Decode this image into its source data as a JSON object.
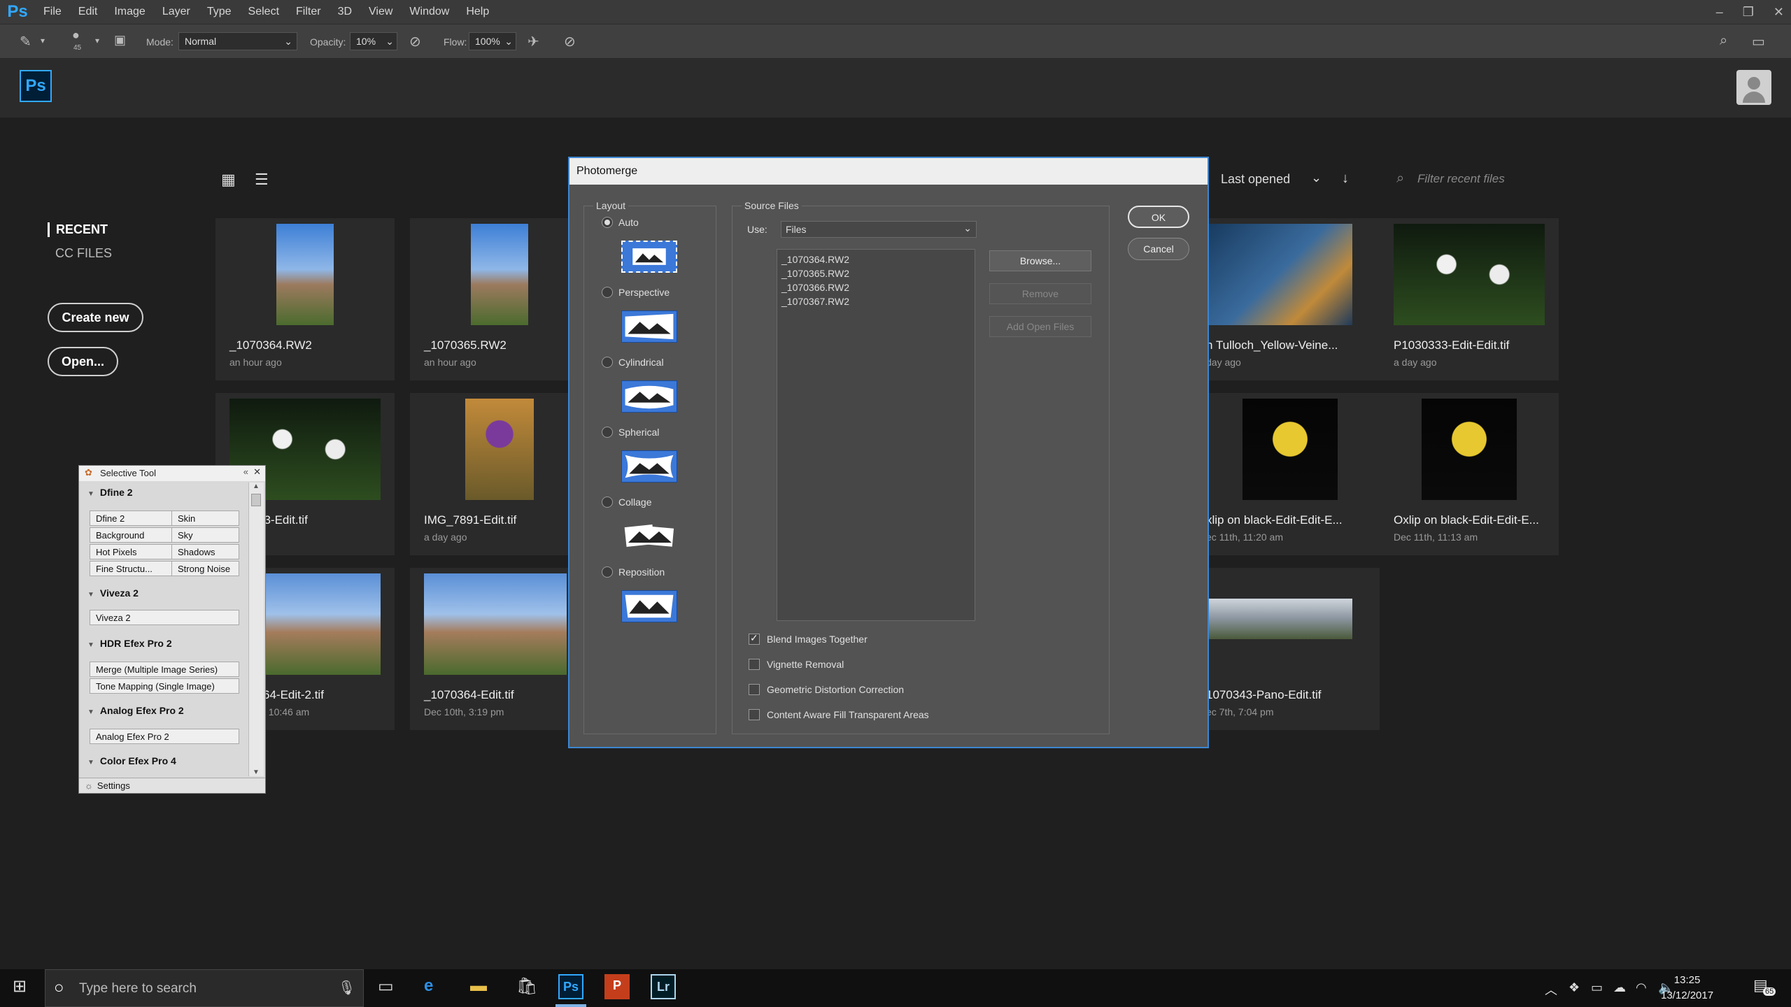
{
  "menubar": {
    "logo": "Ps",
    "items": [
      "File",
      "Edit",
      "Image",
      "Layer",
      "Type",
      "Select",
      "Filter",
      "3D",
      "View",
      "Window",
      "Help"
    ]
  },
  "options": {
    "brush_size": "45",
    "mode_label": "Mode:",
    "mode_value": "Normal",
    "opacity_label": "Opacity:",
    "opacity_value": "10%",
    "flow_label": "Flow:",
    "flow_value": "100%"
  },
  "home": {
    "badge": "Ps",
    "nav_recent": "RECENT",
    "nav_cc": "CC FILES",
    "create_new": "Create new",
    "open": "Open...",
    "sort_label": "Last opened",
    "sort_prefix": "t",
    "filter_placeholder": "Filter recent files"
  },
  "recent_files": [
    {
      "name": "_1070364.RW2",
      "time": "an hour ago"
    },
    {
      "name": "_1070365.RW2",
      "time": "an hour ago"
    },
    {
      "name": "n Tulloch_Yellow-Veine...",
      "time": "day ago"
    },
    {
      "name": "P1030333-Edit-Edit.tif",
      "time": "a day ago"
    },
    {
      "name": "33-Edit.tif",
      "time": "o"
    },
    {
      "name": "IMG_7891-Edit.tif",
      "time": "a day ago"
    },
    {
      "name": "xlip on black-Edit-Edit-E...",
      "time": "ec 11th, 11:20 am"
    },
    {
      "name": "Oxlip on black-Edit-Edit-E...",
      "time": "Dec 11th, 11:13 am"
    },
    {
      "name": "64-Edit-2.tif",
      "time": ", 10:46 am"
    },
    {
      "name": "_1070364-Edit.tif",
      "time": "Dec 10th, 3:19 pm"
    },
    {
      "name": "1070343-Pano-Edit.tif",
      "time": "ec 7th, 7:04 pm"
    }
  ],
  "selective_tool": {
    "title": "Selective Tool",
    "dfine_section": "Dfine 2",
    "dfine_rows": [
      [
        "Dfine 2",
        "Skin"
      ],
      [
        "Background",
        "Sky"
      ],
      [
        "Hot Pixels",
        "Shadows"
      ],
      [
        "Fine Structu...",
        "Strong Noise"
      ]
    ],
    "viveza_section": "Viveza 2",
    "viveza_btn": "Viveza 2",
    "hdr_section": "HDR Efex Pro 2",
    "hdr_btn1": "Merge (Multiple Image Series)",
    "hdr_btn2": "Tone Mapping (Single Image)",
    "analog_section": "Analog Efex Pro 2",
    "analog_btn": "Analog Efex Pro 2",
    "color_section": "Color Efex Pro 4",
    "settings": "Settings"
  },
  "dialog": {
    "title": "Photomerge",
    "layout_label": "Layout",
    "layouts": [
      "Auto",
      "Perspective",
      "Cylindrical",
      "Spherical",
      "Collage",
      "Reposition"
    ],
    "selected_layout": "Auto",
    "source_label": "Source Files",
    "use_label": "Use:",
    "use_value": "Files",
    "files": [
      "_1070364.RW2",
      "_1070365.RW2",
      "_1070366.RW2",
      "_1070367.RW2"
    ],
    "browse": "Browse...",
    "remove": "Remove",
    "add_open": "Add Open Files",
    "ok": "OK",
    "cancel": "Cancel",
    "options": [
      {
        "label": "Blend Images Together",
        "checked": true
      },
      {
        "label": "Vignette Removal",
        "checked": false
      },
      {
        "label": "Geometric Distortion Correction",
        "checked": false
      },
      {
        "label": "Content Aware Fill Transparent Areas",
        "checked": false
      }
    ]
  },
  "taskbar": {
    "search_placeholder": "Type here to search",
    "time": "13:25",
    "date": "13/12/2017",
    "notifications": "65",
    "apps": [
      "Ps",
      "P",
      "Lr"
    ]
  },
  "colors": {
    "ps_blue": "#31a8ff",
    "dialog_border": "#3d86d1",
    "layout_icon_blue": "#3b78d8"
  }
}
